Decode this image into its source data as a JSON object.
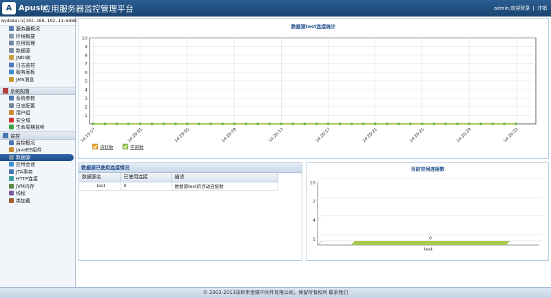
{
  "header": {
    "logo_letter": "A",
    "brand": "Apusic",
    "title": "应用服务器监控管理平台",
    "user": "admin,欢迎登录",
    "separator": "|",
    "logout": "注销"
  },
  "sidebar": {
    "domain": "mydomain[192.168.102.11:6888]",
    "groups": [
      {
        "title": "",
        "items": [
          {
            "label": "服务器概况",
            "icon": "server-icon",
            "color": "#5a7fb0"
          },
          {
            "label": "环境概要",
            "icon": "document-icon",
            "color": "#8899aa"
          },
          {
            "label": "应用管理",
            "icon": "app-icon",
            "color": "#6f86a6"
          },
          {
            "label": "数据源",
            "icon": "database-icon",
            "color": "#7a8fa8"
          },
          {
            "label": "JNDI树",
            "icon": "tree-icon",
            "color": "#c8a040"
          },
          {
            "label": "日志监控",
            "icon": "monitor-icon",
            "color": "#4d79b8"
          },
          {
            "label": "服务面板",
            "icon": "panel-icon",
            "color": "#3f8fd0"
          },
          {
            "label": "JMS消息",
            "icon": "message-icon",
            "color": "#c89a30"
          }
        ]
      },
      {
        "title": "系统配置",
        "icon": "config-icon",
        "color": "#b04040",
        "items": [
          {
            "label": "系统参数",
            "icon": "network-icon",
            "color": "#4b78b5"
          },
          {
            "label": "日志配置",
            "icon": "log-icon",
            "color": "#7a8aa0"
          },
          {
            "label": "用户组",
            "icon": "users-icon",
            "color": "#d08a30"
          },
          {
            "label": "安全域",
            "icon": "security-icon",
            "color": "#d03030"
          },
          {
            "label": "生命周期监听",
            "icon": "lifecycle-icon",
            "color": "#3aa040"
          }
        ]
      },
      {
        "title": "监控",
        "icon": "monitor-section-icon",
        "color": "#4a78b0",
        "items": [
          {
            "label": "监控概况",
            "icon": "chart-icon",
            "color": "#4a78b0",
            "active": false
          },
          {
            "label": "JavaEE组件",
            "icon": "component-icon",
            "color": "#c88a30",
            "active": false
          },
          {
            "label": "数据源",
            "icon": "database-icon",
            "color": "#7a8fa8",
            "active": true
          },
          {
            "label": "应用会话",
            "icon": "session-icon",
            "color": "#3a8fd0",
            "active": false
          },
          {
            "label": "JTA事务",
            "icon": "transaction-icon",
            "color": "#4a78b0",
            "active": false
          },
          {
            "label": "HTTP连接",
            "icon": "http-icon",
            "color": "#3aa0a0",
            "active": false
          },
          {
            "label": "JVM内存",
            "icon": "memory-icon",
            "color": "#5a8a40",
            "active": false
          },
          {
            "label": "线程",
            "icon": "thread-icon",
            "color": "#7a5aa0",
            "active": false
          },
          {
            "label": "类加载",
            "icon": "classload-icon",
            "color": "#a06030",
            "active": false
          }
        ]
      }
    ]
  },
  "chart_data": [
    {
      "type": "line",
      "title": "数据源test连接统计",
      "x": [
        "14:19:57",
        "14:20:01",
        "14:20:05",
        "14:20:09",
        "14:20:13",
        "14:20:17",
        "14:20:21",
        "14:20:25",
        "14:20:29",
        "14:20:33"
      ],
      "series": [
        {
          "name": "活跃数",
          "color": "#e8a020",
          "values": [
            0,
            0,
            0,
            0,
            0,
            0,
            0,
            0,
            0,
            0
          ]
        },
        {
          "name": "空闲数",
          "color": "#8cc63f",
          "values": [
            0,
            0,
            0,
            0,
            0,
            0,
            0,
            0,
            0,
            0
          ]
        }
      ],
      "y_ticks": [
        1,
        2,
        3,
        4,
        5,
        6,
        7,
        8,
        9,
        10
      ],
      "ylim": [
        0,
        10
      ],
      "grid": true,
      "legend": "bottom-left"
    },
    {
      "type": "bar",
      "title": "当前空闲连接数",
      "categories": [
        "test"
      ],
      "values": [
        0
      ],
      "value_labels": [
        "0"
      ],
      "y_ticks": [
        1,
        4,
        7,
        10
      ],
      "ylim": [
        0,
        10
      ],
      "color": "#a8c850",
      "grid": true
    }
  ],
  "table": {
    "title": "数据源已使用连接情况",
    "columns": [
      "数据源名",
      "已使用连接",
      "描述"
    ],
    "rows": [
      [
        "test",
        "0",
        "数据源test的活动连接数"
      ]
    ]
  },
  "footer": {
    "text": "© 2003-2013深圳市金蝶中间件有限公司，保留所有权利 联系我们"
  }
}
